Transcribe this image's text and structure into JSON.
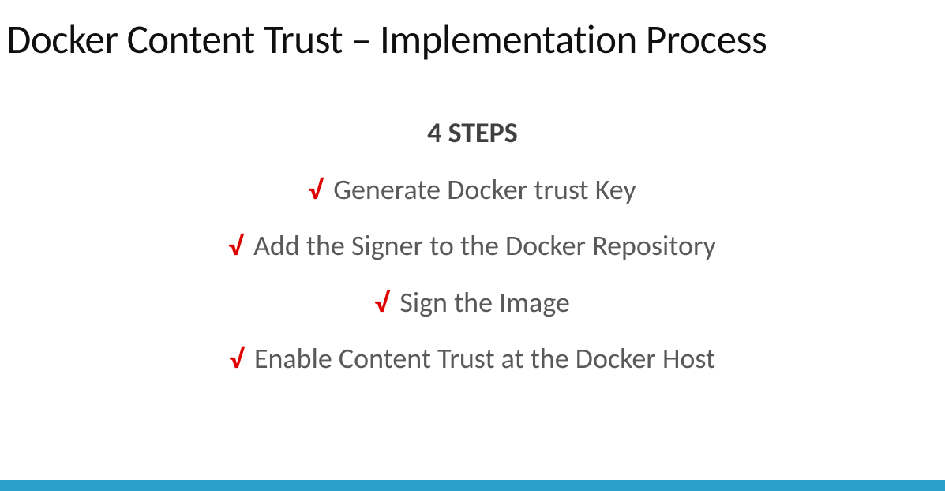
{
  "title": "Docker Content Trust – Implementation Process",
  "heading": "4 STEPS",
  "check_glyph": "√",
  "steps": {
    "s1": "Generate Docker trust Key",
    "s2": "Add the Signer to the Docker Repository",
    "s3": "Sign the Image",
    "s4": "Enable Content Trust at the Docker Host"
  },
  "colors": {
    "check": "#e00000",
    "body_text": "#595959",
    "rule": "#a6a6a6",
    "accent_bar": "#2aa0c8"
  }
}
